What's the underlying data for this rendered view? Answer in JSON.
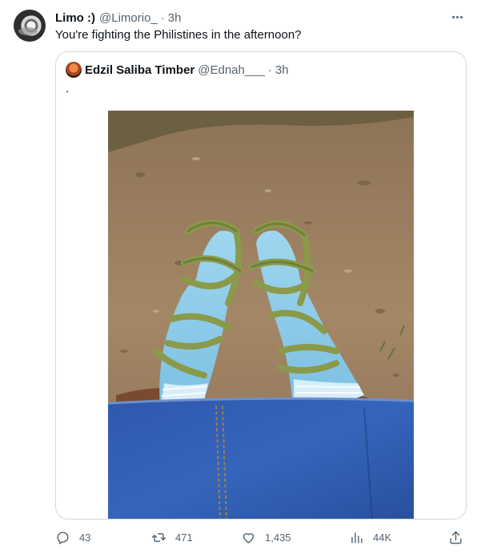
{
  "tweet": {
    "author_name": "Limo :)",
    "author_handle": "@Limorio_",
    "separator": "·",
    "time": "3h",
    "text": "You're fighting the Philistines in the afternoon?"
  },
  "quoted_tweet": {
    "author_name": "Edzil Saliba Timber",
    "author_handle": "@Ednah___",
    "separator": "·",
    "time": "3h",
    "text": "."
  },
  "actions": {
    "replies": "43",
    "retweets": "471",
    "likes": "1,435",
    "views": "44K"
  },
  "icons": {
    "more": "more-horizontal-icon",
    "reply": "reply-icon",
    "retweet": "retweet-icon",
    "like": "heart-icon",
    "views": "views-chart-icon",
    "share": "share-icon"
  },
  "colors": {
    "text_primary": "#0f1419",
    "text_secondary": "#536471",
    "border": "#cfd9de"
  }
}
